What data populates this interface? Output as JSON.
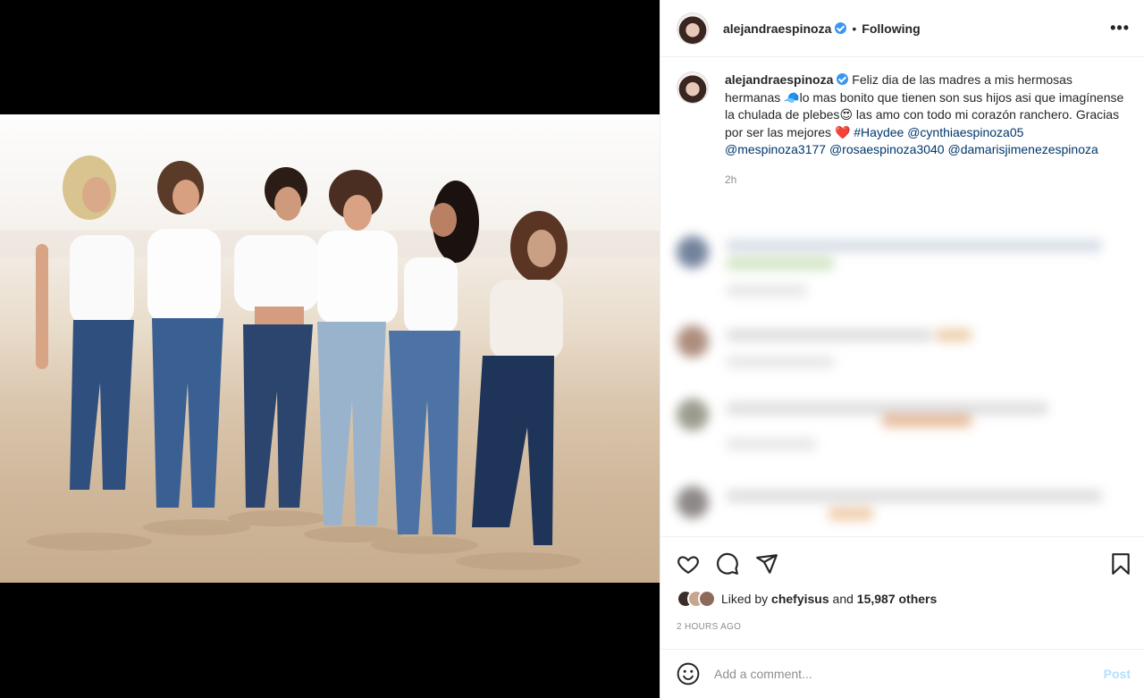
{
  "post": {
    "username": "alejandraespinoza",
    "following_label": "Following",
    "more_label": "•••"
  },
  "caption": {
    "username": "alejandraespinoza",
    "text_1": "Feliz dia de las madres a mis hermosas hermanas ",
    "text_2": "lo mas bonito que tienen son sus hijos asi que imagínense la chulada de plebes",
    "text_3": " las amo con todo mi corazón ranchero. Gracias por ser las mejores ",
    "emoji_cap": "🧢",
    "emoji_eyes": "😍",
    "emoji_heart": "❤️",
    "hashtag": "#Haydee",
    "mentions": [
      "@cynthiaespinoza05",
      "@mespinoza3177",
      "@rosaespinoza3040",
      "@damarisjimenezespinoza"
    ],
    "age": "2h"
  },
  "likes": {
    "prefix": "Liked by ",
    "user": "chefyisus",
    "middle": " and ",
    "count": "15,987 others"
  },
  "timestamp": "2 HOURS AGO",
  "comment_box": {
    "placeholder": "Add a comment...",
    "post_label": "Post"
  },
  "colors": {
    "link": "#00376b",
    "verified": "#3897f0",
    "post_disabled": "#b2dffc"
  }
}
